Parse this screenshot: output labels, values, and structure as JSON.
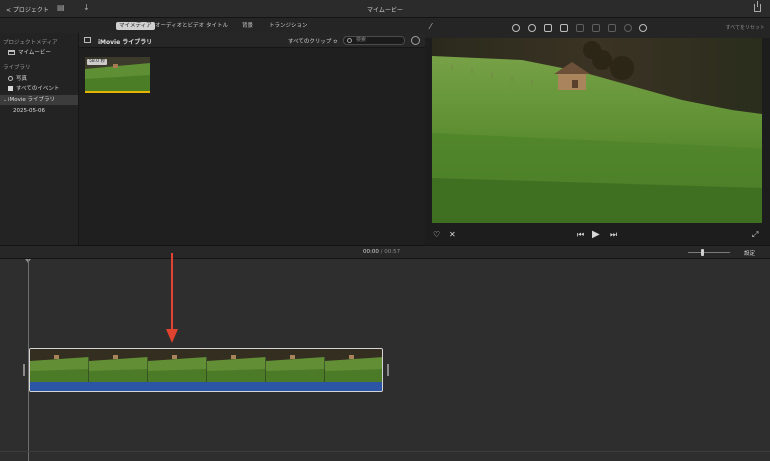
{
  "titlebar": {
    "back_label": "< プロジェクト",
    "window_title": "マイムービー"
  },
  "media_tabs": [
    "マイメディア",
    "オーディオとビデオ",
    "タイトル",
    "背景",
    "トランジション"
  ],
  "media_tabs_active": 0,
  "sidebar": {
    "project_media_heading": "プロジェクトメディア",
    "project_item": "マイムービー",
    "libraries_heading": "ライブラリ",
    "photos_item": "写真",
    "all_events_item": "すべてのイベント",
    "library_item": "iMovie ライブラリ",
    "event_item": "2025-05-06"
  },
  "browser": {
    "library_title": "iMovie ライブラリ",
    "filter_label": "すべてのクリップ ≎",
    "search_placeholder": "検索",
    "clip_duration": "58.0 秒"
  },
  "viewer": {
    "reset_all_label": "すべてをリセット"
  },
  "timeline": {
    "current_time": "00:00",
    "separator": "/",
    "total_time": "00:57",
    "settings_label": "設定"
  },
  "colors": {
    "accent_selection": "#d0d0d0",
    "clip_audio": "#2d55a6",
    "clip_range_bar": "#e6b400",
    "annotation_arrow": "#e0432f"
  }
}
